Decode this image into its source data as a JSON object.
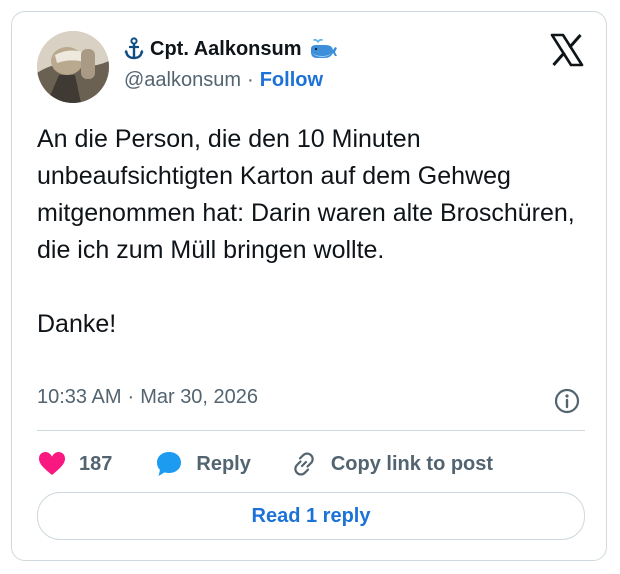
{
  "author": {
    "display_name": "Cpt. Aalkonsum",
    "handle": "@aalkonsum",
    "separator": "·",
    "follow_label": "Follow"
  },
  "tweet": {
    "text": "An die Person, die den 10 Minuten unbeaufsichtigten Karton auf dem Gehweg mitgenommen hat: Darin waren alte Broschüren, die ich zum Müll bringen wollte.\n\nDanke!",
    "time": "10:33 AM",
    "separator": "·",
    "date": "Mar 30, 2026"
  },
  "actions": {
    "like_count": "187",
    "reply_label": "Reply",
    "copy_link_label": "Copy link to post"
  },
  "read_replies_label": "Read 1 reply",
  "icons": {
    "avatar": "avatar",
    "anchor": "anchor-icon",
    "whale": "whale-icon",
    "platform": "x-logo-icon",
    "info": "info-icon",
    "like": "heart-icon",
    "reply": "speech-bubble-icon",
    "copy_link": "link-icon"
  },
  "colors": {
    "accent": "#1d72d8",
    "heart": "#f91880",
    "reply_bubble": "#1d9bf0",
    "muted_text": "#536471",
    "border": "#cfd9de"
  }
}
